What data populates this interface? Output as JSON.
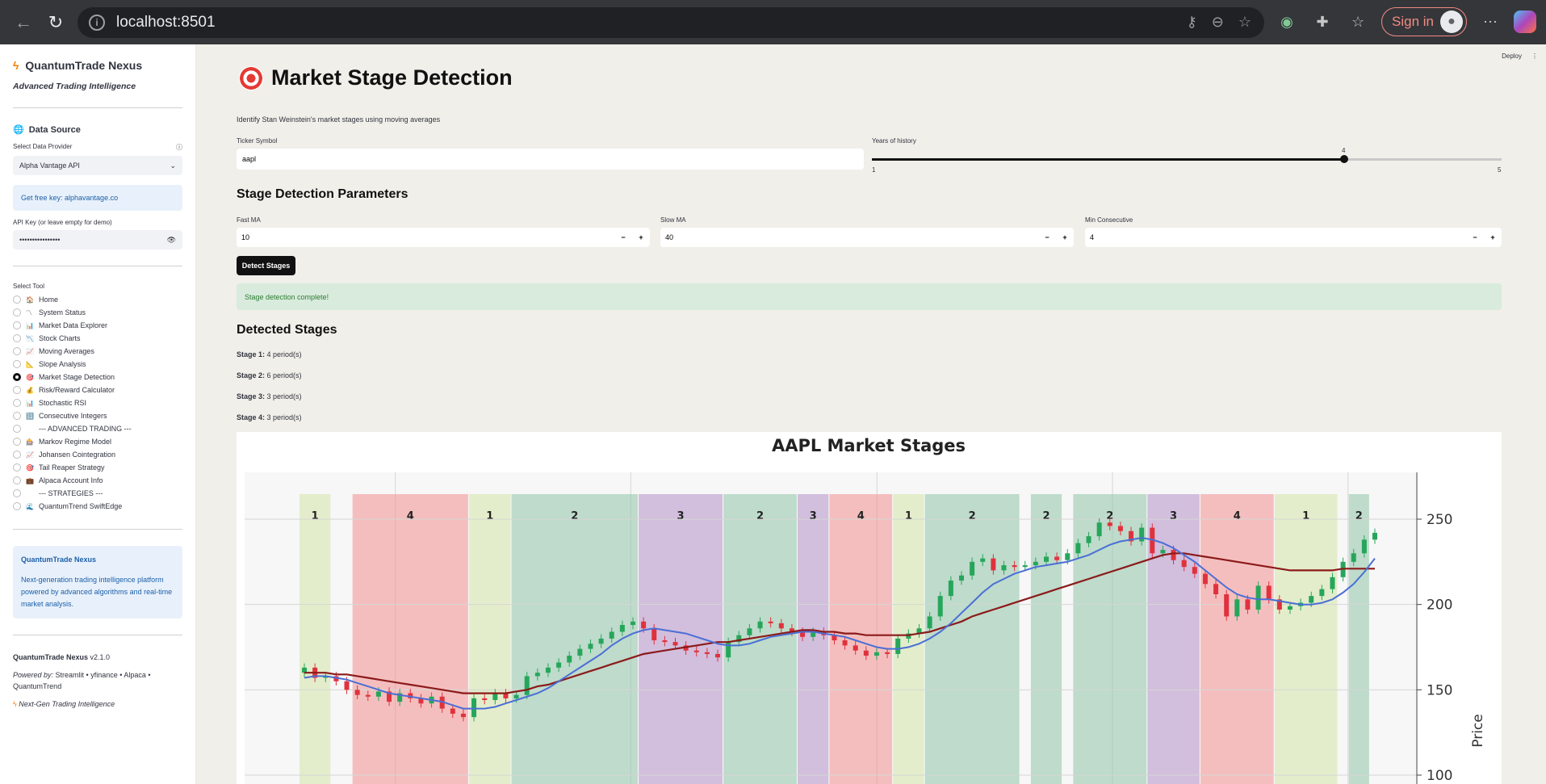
{
  "browser": {
    "url": "localhost:8501",
    "signin_label": "Sign in"
  },
  "sidebar": {
    "app_title": "QuantumTrade Nexus",
    "app_subtitle": "Advanced Trading Intelligence",
    "data_source_heading": "Data Source",
    "provider_label": "Select Data Provider",
    "provider_value": "Alpha Vantage API",
    "free_key_text": "Get free key: alphavantage.co",
    "api_key_label": "API Key (or leave empty for demo)",
    "api_key_value": "••••••••••••••••",
    "select_tool_label": "Select Tool",
    "tools": [
      {
        "icon": "🏠",
        "label": "Home"
      },
      {
        "icon": "〽",
        "label": "System Status"
      },
      {
        "icon": "📊",
        "label": "Market Data Explorer"
      },
      {
        "icon": "📉",
        "label": "Stock Charts"
      },
      {
        "icon": "📈",
        "label": "Moving Averages"
      },
      {
        "icon": "📐",
        "label": "Slope Analysis"
      },
      {
        "icon": "🎯",
        "label": "Market Stage Detection"
      },
      {
        "icon": "💰",
        "label": "Risk/Reward Calculator"
      },
      {
        "icon": "📊",
        "label": "Stochastic RSI"
      },
      {
        "icon": "🔢",
        "label": "Consecutive Integers"
      },
      {
        "icon": "",
        "label": "--- ADVANCED TRADING ---"
      },
      {
        "icon": "🎰",
        "label": "Markov Regime Model"
      },
      {
        "icon": "📈",
        "label": "Johansen Cointegration"
      },
      {
        "icon": "🎯",
        "label": "Tail Reaper Strategy"
      },
      {
        "icon": "💼",
        "label": "Alpaca Account Info"
      },
      {
        "icon": "",
        "label": "--- STRATEGIES ---"
      },
      {
        "icon": "🌊",
        "label": "QuantumTrend SwiftEdge"
      }
    ],
    "selected_tool_index": 6,
    "nexus_box_title": "QuantumTrade Nexus",
    "nexus_box_text": "Next-generation trading intelligence platform powered by advanced algorithms and real-time market analysis.",
    "footer_name": "QuantumTrade Nexus",
    "footer_version": "v2.1.0",
    "footer_powered_label": "Powered by:",
    "footer_powered_value": "Streamlit • yfinance • Alpaca • QuantumTrend",
    "footer_tagline": "Next-Gen Trading Intelligence"
  },
  "main": {
    "deploy_label": "Deploy",
    "title": "Market Stage Detection",
    "subtitle": "Identify Stan Weinstein's market stages using moving averages",
    "ticker_label": "Ticker Symbol",
    "ticker_value": "aapl",
    "years_label": "Years of history",
    "years_value": 4,
    "years_min": 1,
    "years_max": 5,
    "params_heading": "Stage Detection Parameters",
    "fast_ma_label": "Fast MA",
    "fast_ma_value": "10",
    "slow_ma_label": "Slow MA",
    "slow_ma_value": "40",
    "min_consec_label": "Min Consecutive",
    "min_consec_value": "4",
    "detect_button": "Detect Stages",
    "success_message": "Stage detection complete!",
    "detected_heading": "Detected Stages",
    "stages": [
      {
        "label": "Stage 1:",
        "value": "4 period(s)"
      },
      {
        "label": "Stage 2:",
        "value": "6 period(s)"
      },
      {
        "label": "Stage 3:",
        "value": "3 period(s)"
      },
      {
        "label": "Stage 4:",
        "value": "3 period(s)"
      }
    ]
  },
  "chart_data": {
    "type": "candlestick",
    "title": "AAPL Market Stages",
    "ylabel": "Price",
    "ylim": [
      100,
      270
    ],
    "yticks": [
      100,
      150,
      200,
      250
    ],
    "grid": true,
    "stage_colors": {
      "1": "#d4e6a8",
      "2": "#8fc4a8",
      "3": "#b48fc8",
      "4": "#f48f8f"
    },
    "stage_bands": [
      {
        "stage": "1",
        "start": 0,
        "end": 2
      },
      {
        "stage": "4",
        "start": 5,
        "end": 15
      },
      {
        "stage": "1",
        "start": 16,
        "end": 19
      },
      {
        "stage": "2",
        "start": 20,
        "end": 31
      },
      {
        "stage": "3",
        "start": 32,
        "end": 39
      },
      {
        "stage": "2",
        "start": 40,
        "end": 46
      },
      {
        "stage": "3",
        "start": 47,
        "end": 49
      },
      {
        "stage": "4",
        "start": 50,
        "end": 55
      },
      {
        "stage": "1",
        "start": 56,
        "end": 58
      },
      {
        "stage": "2",
        "start": 59,
        "end": 67
      },
      {
        "stage": "2",
        "start": 69,
        "end": 71
      },
      {
        "stage": "2",
        "start": 73,
        "end": 79
      },
      {
        "stage": "3",
        "start": 80,
        "end": 84
      },
      {
        "stage": "4",
        "start": 85,
        "end": 91
      },
      {
        "stage": "1",
        "start": 92,
        "end": 97
      },
      {
        "stage": "2",
        "start": 99,
        "end": 100
      }
    ],
    "close": [
      163,
      157,
      158,
      155,
      150,
      147,
      146,
      149,
      143,
      148,
      145,
      142,
      146,
      139,
      136,
      134,
      145,
      144,
      148,
      145,
      147,
      158,
      160,
      163,
      166,
      170,
      174,
      177,
      180,
      184,
      188,
      190,
      186,
      179,
      178,
      176,
      173,
      172,
      171,
      169,
      178,
      182,
      186,
      190,
      189,
      186,
      184,
      181,
      184,
      182,
      179,
      176,
      173,
      170,
      172,
      171,
      180,
      183,
      186,
      193,
      205,
      214,
      217,
      225,
      227,
      220,
      223,
      222,
      223,
      225,
      228,
      226,
      230,
      236,
      240,
      248,
      246,
      243,
      237,
      245,
      230,
      232,
      226,
      222,
      218,
      212,
      206,
      193,
      203,
      197,
      211,
      203,
      197,
      199,
      201,
      205,
      209,
      216,
      225,
      230,
      238,
      242
    ],
    "fast_ma": [
      157,
      158,
      158,
      157,
      156,
      154,
      152,
      150,
      148,
      147,
      146,
      145,
      144,
      143,
      141,
      139,
      139,
      139,
      140,
      142,
      144,
      146,
      148,
      151,
      155,
      159,
      163,
      167,
      171,
      176,
      180,
      183,
      185,
      186,
      185,
      184,
      183,
      181,
      179,
      177,
      176,
      176,
      177,
      179,
      181,
      182,
      183,
      184,
      184,
      183,
      182,
      181,
      179,
      177,
      175,
      174,
      174,
      175,
      177,
      180,
      184,
      189,
      195,
      201,
      207,
      212,
      215,
      218,
      220,
      222,
      223,
      224,
      225,
      227,
      229,
      232,
      235,
      237,
      238,
      239,
      238,
      236,
      233,
      229,
      225,
      220,
      215,
      210,
      206,
      204,
      203,
      203,
      202,
      201,
      200,
      200,
      201,
      203,
      207,
      212,
      219,
      227
    ],
    "slow_ma": [
      160,
      160,
      160,
      159,
      159,
      158,
      157,
      156,
      155,
      154,
      153,
      152,
      151,
      150,
      149,
      148,
      148,
      148,
      148,
      148,
      149,
      150,
      152,
      153,
      155,
      157,
      159,
      161,
      163,
      165,
      167,
      169,
      171,
      172,
      173,
      174,
      175,
      176,
      177,
      178,
      178,
      179,
      180,
      181,
      182,
      183,
      184,
      185,
      185,
      184,
      184,
      183,
      183,
      182,
      182,
      182,
      182,
      182,
      183,
      184,
      186,
      188,
      190,
      193,
      195,
      197,
      199,
      201,
      203,
      205,
      207,
      209,
      211,
      213,
      215,
      217,
      219,
      221,
      223,
      225,
      227,
      229,
      230,
      230,
      229,
      228,
      227,
      226,
      225,
      224,
      223,
      222,
      221,
      220,
      220,
      220,
      220,
      220,
      221,
      221,
      221,
      221
    ]
  }
}
